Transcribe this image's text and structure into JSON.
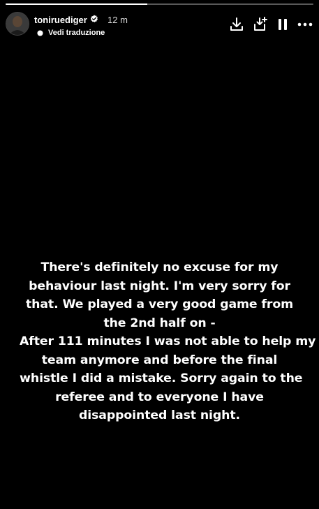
{
  "story": {
    "progress_fraction": 0.46,
    "username": "toniruediger",
    "verified": true,
    "timestamp": "12 m",
    "translate_label": "Vedi traduzione",
    "caption_lines": [
      "There's definitely no excuse for my",
      "behaviour last night. I'm very sorry for",
      "that. We played a very good game from",
      "the 2nd half on -",
      "After 111 minutes I was not able to help my",
      "team anymore and before the final",
      "whistle I did a mistake. Sorry again to the",
      "referee and to everyone I have",
      "disappointed last night."
    ]
  },
  "icons": {
    "verified": "verified-badge-icon",
    "translate": "translate-dot-icon",
    "download": "download-icon",
    "save": "save-to-device-icon",
    "pause": "pause-icon",
    "more": "more-options-icon"
  },
  "colors": {
    "background": "#000000",
    "text": "#ffffff",
    "progress_track": "rgba(255,255,255,0.35)",
    "progress_fill": "#ffffff"
  }
}
